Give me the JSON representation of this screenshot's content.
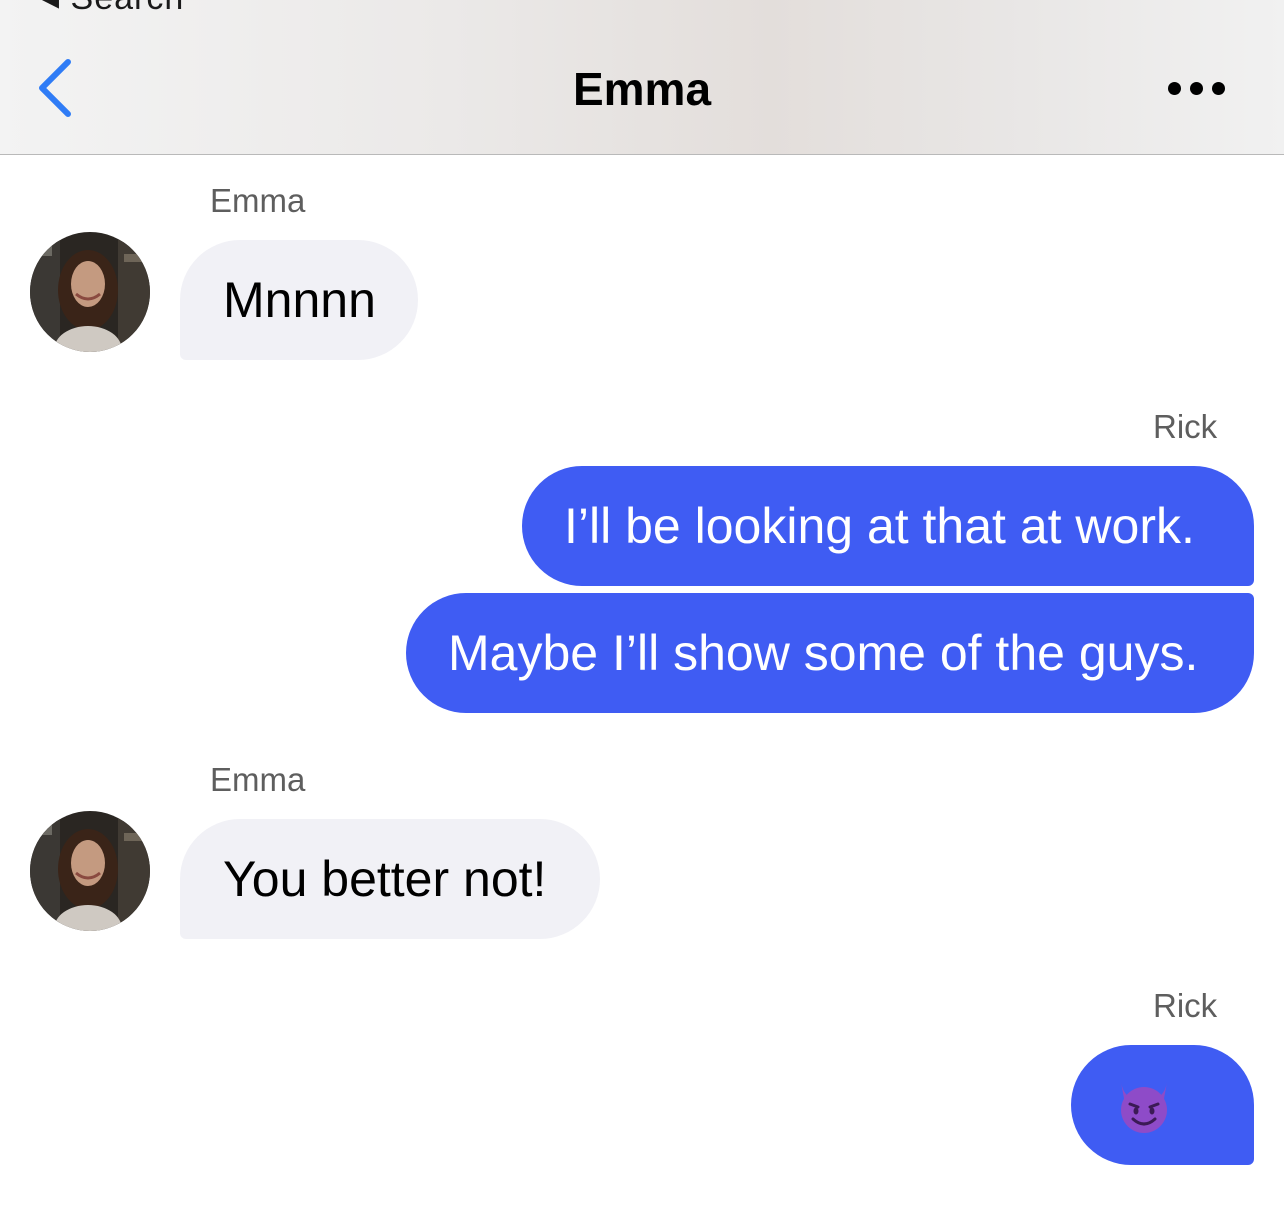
{
  "header": {
    "back_hint": "◂ Search",
    "title": "Emma"
  },
  "messages": [
    {
      "sender": "Emma",
      "text": "Mnnnn",
      "direction": "incoming"
    },
    {
      "sender": "Rick",
      "text": "I’ll be looking at that at work.",
      "direction": "outgoing"
    },
    {
      "sender": "Rick",
      "text": "Maybe I’ll show some of the guys.",
      "direction": "outgoing"
    },
    {
      "sender": "Emma",
      "text": "You better not!",
      "direction": "incoming"
    },
    {
      "sender": "Rick",
      "text": "",
      "emoji": "smiling-devil-emoji",
      "direction": "outgoing"
    }
  ],
  "colors": {
    "outgoing_bubble": "#3f5cf3",
    "incoming_bubble": "#f1f1f6",
    "back_arrow": "#2f7cf6"
  },
  "icons": {
    "back": "chevron-left-icon",
    "more": "more-horizontal-icon",
    "avatar": "avatar"
  }
}
